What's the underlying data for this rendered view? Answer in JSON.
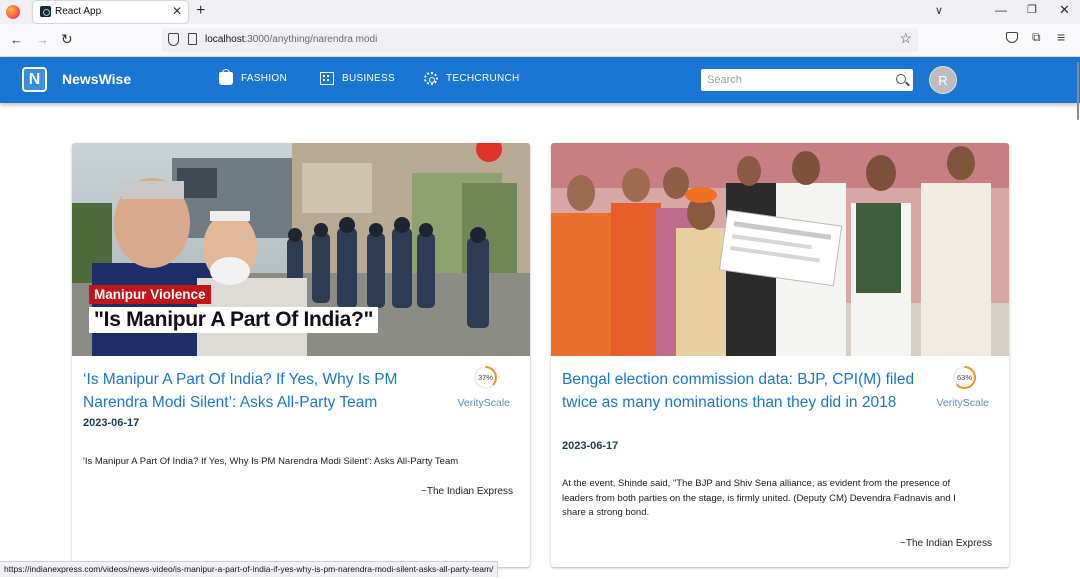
{
  "browser": {
    "tab_title": "React App",
    "url_host": "localhost",
    "url_rest": ":3000/anything/narendra modi",
    "status_url": "https://indianexpress.com/videos/news-video/is-manipur-a-part-of-india-if-yes-why-is-pm-narendra-modi-silent-asks-all-party-team/"
  },
  "header": {
    "logo_letter": "N",
    "brand": "NewsWise",
    "nav": [
      {
        "label": "FASHION",
        "icon": "shopping-bag-icon"
      },
      {
        "label": "BUSINESS",
        "icon": "building-icon"
      },
      {
        "label": "TECHCRUNCH",
        "icon": "gear-icon"
      }
    ],
    "search_placeholder": "Search",
    "avatar_letter": "R",
    "brand_color": "#1976d2"
  },
  "cards": [
    {
      "title": "‘Is Manipur A Part Of India? If Yes, Why Is PM Narendra Modi Silent’: Asks All-Party Team",
      "date": "2023-06-17",
      "description": "'Is Manipur A Part Of India? If Yes, Why Is PM Narendra Modi Silent': Asks All-Party Team",
      "source": "~The Indian Express",
      "score_text": "37%",
      "score_value": 37,
      "score_label": "VerityScale",
      "image_tag": "Manipur Violence",
      "image_quote": "\"Is Manipur A Part Of India?\""
    },
    {
      "title": "Bengal election commission data: BJP, CPI(M) filed twice as many nominations than they did in 2018",
      "date": "2023-06-17",
      "description": "At the event, Shinde said, \"The BJP and Shiv Sena alliance, as evident from the presence of leaders from both parties on the stage, is firmly united. (Deputy CM) Devendra Fadnavis and I share a strong bond.",
      "source": "~The Indian Express",
      "score_text": "63%",
      "score_value": 63,
      "score_label": "VerityScale"
    }
  ]
}
